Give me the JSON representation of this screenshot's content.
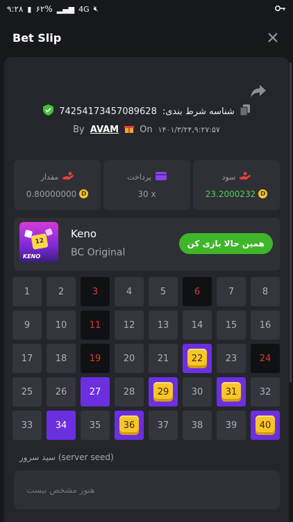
{
  "statusbar": {
    "time": "۹:۲۸",
    "battery": "۶۲%",
    "network": "4G"
  },
  "header": {
    "title": "Bet Slip"
  },
  "bet": {
    "id_label": "شناسه شرط بندی:",
    "id_value": "74254173457089628",
    "by_label": "By",
    "username": "AVAM",
    "on_label": "On",
    "date": "۱۴۰۱/۳/۲۴,۹:۲۷:۵۷"
  },
  "stats": {
    "amount": {
      "label": "مقدار",
      "value": "0.80000000"
    },
    "payout": {
      "label": "پرداخت",
      "value": "30 x"
    },
    "profit": {
      "label": "سود",
      "value": "23.2000232"
    }
  },
  "game": {
    "name": "Keno",
    "provider": "BC Original",
    "thumb_text": "KENO",
    "play_label": "همین حالا بازی کن"
  },
  "board": {
    "cells": [
      {
        "n": "1",
        "s": "normal"
      },
      {
        "n": "2",
        "s": "normal"
      },
      {
        "n": "3",
        "s": "drawn"
      },
      {
        "n": "4",
        "s": "normal"
      },
      {
        "n": "5",
        "s": "normal"
      },
      {
        "n": "6",
        "s": "drawn"
      },
      {
        "n": "7",
        "s": "normal"
      },
      {
        "n": "8",
        "s": "normal"
      },
      {
        "n": "9",
        "s": "normal"
      },
      {
        "n": "10",
        "s": "normal"
      },
      {
        "n": "11",
        "s": "drawn"
      },
      {
        "n": "12",
        "s": "normal"
      },
      {
        "n": "13",
        "s": "normal"
      },
      {
        "n": "14",
        "s": "normal"
      },
      {
        "n": "15",
        "s": "normal"
      },
      {
        "n": "16",
        "s": "normal"
      },
      {
        "n": "17",
        "s": "normal"
      },
      {
        "n": "18",
        "s": "normal"
      },
      {
        "n": "19",
        "s": "drawn"
      },
      {
        "n": "20",
        "s": "normal"
      },
      {
        "n": "21",
        "s": "normal"
      },
      {
        "n": "22",
        "s": "hit"
      },
      {
        "n": "23",
        "s": "normal"
      },
      {
        "n": "24",
        "s": "drawn"
      },
      {
        "n": "25",
        "s": "normal"
      },
      {
        "n": "26",
        "s": "normal"
      },
      {
        "n": "27",
        "s": "picked"
      },
      {
        "n": "28",
        "s": "normal"
      },
      {
        "n": "29",
        "s": "hit"
      },
      {
        "n": "30",
        "s": "normal"
      },
      {
        "n": "31",
        "s": "hit"
      },
      {
        "n": "32",
        "s": "normal"
      },
      {
        "n": "33",
        "s": "normal"
      },
      {
        "n": "34",
        "s": "picked"
      },
      {
        "n": "35",
        "s": "normal"
      },
      {
        "n": "36",
        "s": "hit"
      },
      {
        "n": "37",
        "s": "normal"
      },
      {
        "n": "38",
        "s": "normal"
      },
      {
        "n": "39",
        "s": "normal"
      },
      {
        "n": "40",
        "s": "hit"
      }
    ]
  },
  "server_seed": {
    "label": "سید سرور (server seed)",
    "placeholder": "هنوز مشخص نیست"
  },
  "colors": {
    "picked": "#6c2fe0",
    "drawn_text": "#e2352c",
    "hit_gem": "#f8c628",
    "play_button": "#3fb52a",
    "profit_text": "#4fd24f"
  }
}
